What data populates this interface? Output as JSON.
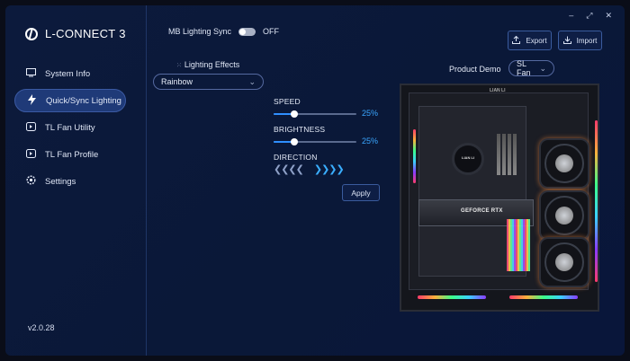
{
  "app": {
    "title": "L-CONNECT 3",
    "version": "v2.0.28"
  },
  "window_controls": {
    "minimize": "–",
    "maximize": "⤢",
    "close": "✕"
  },
  "sidebar": {
    "items": [
      {
        "label": "System Info",
        "icon": "monitor-icon",
        "active": false
      },
      {
        "label": "Quick/Sync Lighting",
        "icon": "lightning-icon",
        "active": true
      },
      {
        "label": "TL Fan Utility",
        "icon": "fan-utility-icon",
        "active": false
      },
      {
        "label": "TL Fan Profile",
        "icon": "fan-profile-icon",
        "active": false
      },
      {
        "label": "Settings",
        "icon": "gear-icon",
        "active": false
      }
    ]
  },
  "sync": {
    "label": "MB Lighting Sync",
    "state": "OFF"
  },
  "toolbar": {
    "export_label": "Export",
    "import_label": "Import"
  },
  "effects": {
    "label": "Lighting Effects",
    "selected": "Rainbow"
  },
  "controls": {
    "speed_label": "SPEED",
    "speed_value": "25%",
    "speed_fraction": 0.25,
    "brightness_label": "BRIGHTNESS",
    "brightness_value": "25%",
    "brightness_fraction": 0.25,
    "direction_label": "DIRECTION",
    "apply_label": "Apply"
  },
  "demo": {
    "label": "Product Demo",
    "selected": "SL Fan"
  },
  "preview": {
    "case_brand": "LIAN LI",
    "gpu_text": "GEFORCE RTX",
    "pump_text": "LIAN LI"
  },
  "colors": {
    "accent": "#2f8fff",
    "active_nav": "#1f3a78",
    "background": "#0b1a3d"
  }
}
